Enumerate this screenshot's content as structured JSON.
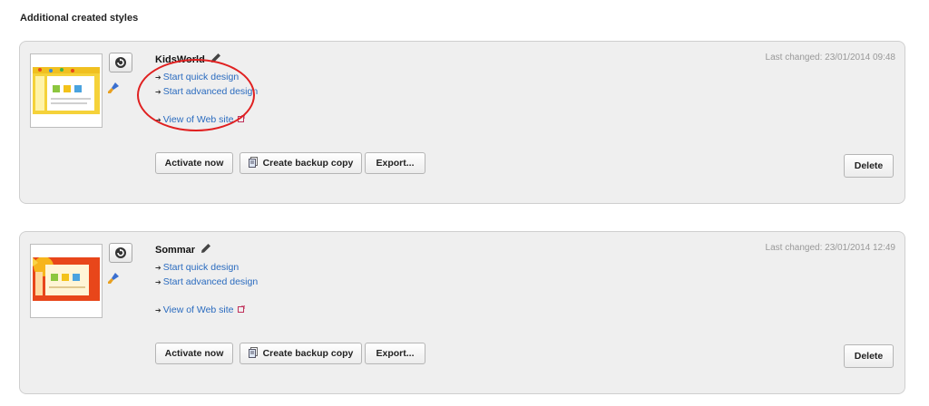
{
  "section": {
    "title": "Additional created styles"
  },
  "styles": [
    {
      "name": "KidsWorld",
      "last_changed": "Last changed: 23/01/2014 09:48",
      "links": {
        "quick": "Start quick design",
        "advanced": "Start advanced design",
        "view": "View of Web site"
      },
      "buttons": {
        "activate": "Activate now",
        "backup": "Create backup copy",
        "export": "Export...",
        "delete": "Delete"
      }
    },
    {
      "name": "Sommar",
      "last_changed": "Last changed: 23/01/2014 12:49",
      "links": {
        "quick": "Start quick design",
        "advanced": "Start advanced design",
        "view": "View of Web site"
      },
      "buttons": {
        "activate": "Activate now",
        "backup": "Create backup copy",
        "export": "Export...",
        "delete": "Delete"
      }
    }
  ],
  "colors": {
    "link": "#2a6bbf",
    "card_bg": "#efefef",
    "annotation": "#e02020"
  }
}
